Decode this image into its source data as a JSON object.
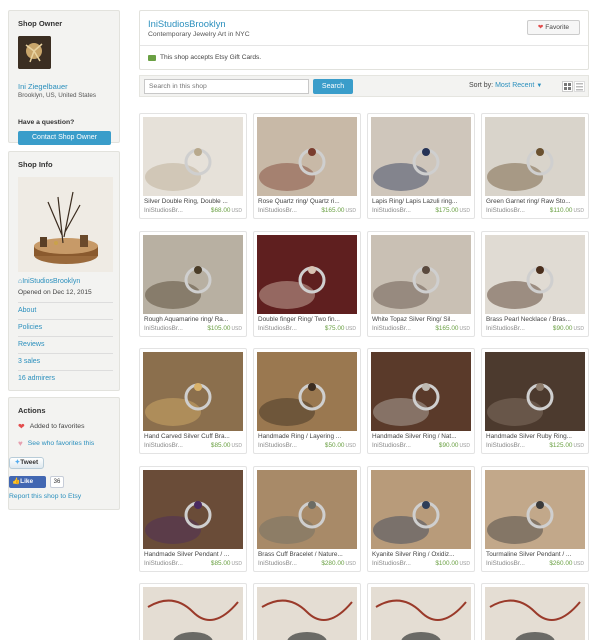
{
  "owner": {
    "heading": "Shop Owner",
    "name": "Ini Ziegelbauer",
    "location": "Brooklyn, US, United States",
    "question": "Have a question?",
    "contact_label": "Contact Shop Owner"
  },
  "info": {
    "heading": "Shop Info",
    "shop_link": "IniStudiosBrooklyn",
    "opened": "Opened on Dec 12, 2015",
    "links": [
      "About",
      "Policies",
      "Reviews",
      "3 sales",
      "16 admirers"
    ]
  },
  "actions": {
    "heading": "Actions",
    "added": "Added to favorites",
    "see_who": "See who favorites this",
    "tweet": "Tweet",
    "like": "Like",
    "like_count": "36",
    "report": "Report this shop to Etsy"
  },
  "header": {
    "shop_name": "IniStudiosBrooklyn",
    "tagline": "Contemporary Jewelry Art in NYC",
    "favorite": "Favorite",
    "gift_cards": "This shop accepts Etsy Gift Cards."
  },
  "toolbar": {
    "search_placeholder": "Search in this shop",
    "search_label": "Search",
    "sort_prefix": "Sort by:",
    "sort_value": "Most Recent"
  },
  "colors": {
    "link": "#2a8fbd",
    "button": "#3a9dca",
    "price": "#6aa043",
    "heart": "#e34d4d"
  },
  "currency": "USD",
  "listings": [
    {
      "title": "Silver Double Ring, Double ...",
      "shop": "IniStudiosBr...",
      "price": "$68.00",
      "icon": "ring-photo"
    },
    {
      "title": "Rose Quartz ring/ Quartz ri...",
      "shop": "IniStudiosBr...",
      "price": "$165.00",
      "icon": "ring-photo"
    },
    {
      "title": "Lapis Ring/ Lapis Lazuli ring...",
      "shop": "IniStudiosBr...",
      "price": "$175.00",
      "icon": "ring-photo"
    },
    {
      "title": "Green Garnet ring/ Raw Sto...",
      "shop": "IniStudiosBr...",
      "price": "$110.00",
      "icon": "ring-photo"
    },
    {
      "title": "Rough Aquamarine ring/ Ra...",
      "shop": "IniStudiosBr...",
      "price": "$105.00",
      "icon": "ring-photo"
    },
    {
      "title": "Double finger Ring/ Two fin...",
      "shop": "IniStudiosBr...",
      "price": "$75.00",
      "icon": "ring-photo"
    },
    {
      "title": "White Topaz Silver Ring/ Sil...",
      "shop": "IniStudiosBr...",
      "price": "$165.00",
      "icon": "ring-photo"
    },
    {
      "title": "Brass Pearl Necklace / Bras...",
      "shop": "IniStudiosBr...",
      "price": "$90.00",
      "icon": "necklace-photo"
    },
    {
      "title": "Hand Carved Silver Cuff Bra...",
      "shop": "IniStudiosBr...",
      "price": "$85.00",
      "icon": "cuff-photo"
    },
    {
      "title": "Handmade Ring / Layering ...",
      "shop": "IniStudiosBr...",
      "price": "$50.00",
      "icon": "ring-photo"
    },
    {
      "title": "Handmade Silver Ring / Nat...",
      "shop": "IniStudiosBr...",
      "price": "$90.00",
      "icon": "ring-photo"
    },
    {
      "title": "Handmade Silver Ruby Ring...",
      "shop": "IniStudiosBr...",
      "price": "$125.00",
      "icon": "ring-photo"
    },
    {
      "title": "Handmade Silver Pendant / ...",
      "shop": "IniStudiosBr...",
      "price": "$85.00",
      "icon": "pendant-photo"
    },
    {
      "title": "Brass Cuff Bracelet / Nature...",
      "shop": "IniStudiosBr...",
      "price": "$280.00",
      "icon": "cuff-photo"
    },
    {
      "title": "Kyanite Silver Ring / Oxidiz...",
      "shop": "IniStudiosBr...",
      "price": "$100.00",
      "icon": "ring-photo"
    },
    {
      "title": "Tourmaline Silver Pendant / ...",
      "shop": "IniStudiosBr...",
      "price": "$260.00",
      "icon": "pendant-photo"
    }
  ]
}
